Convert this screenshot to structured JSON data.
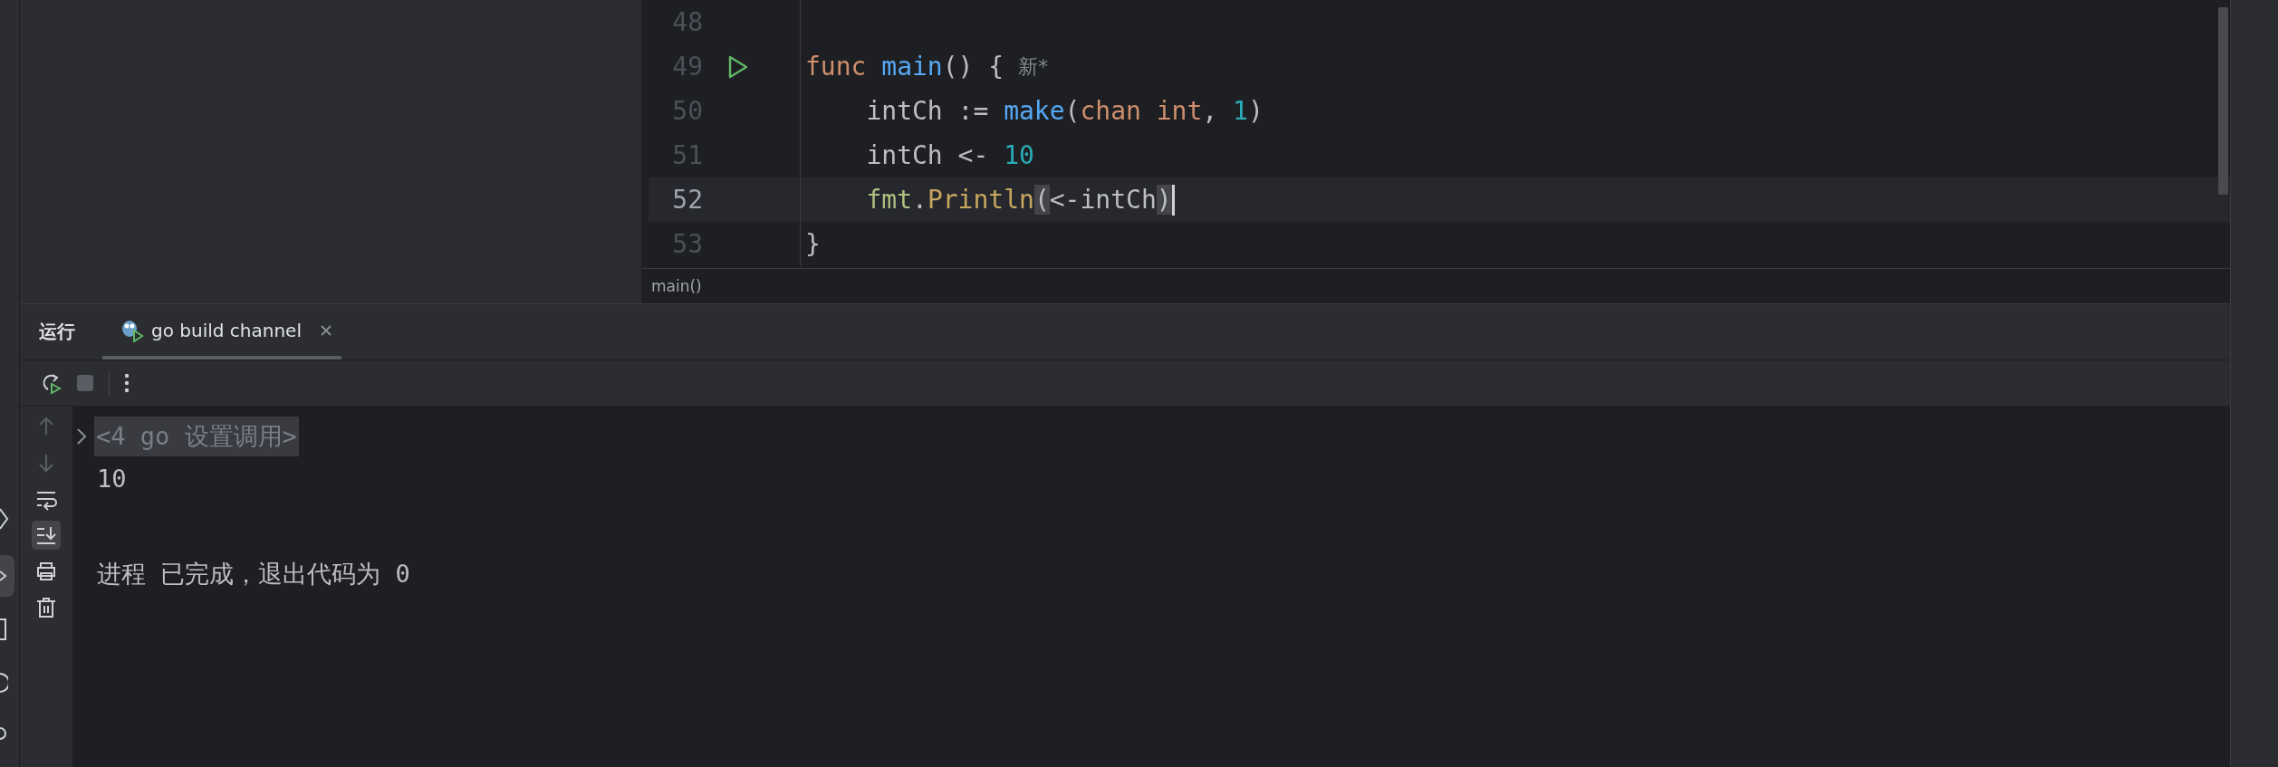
{
  "editor": {
    "lines": [
      {
        "number": "48",
        "current": false
      },
      {
        "number": "49",
        "current": false,
        "run_icon": true,
        "hint": "新*",
        "tokens": [
          {
            "kind": "keyword",
            "text": "func "
          },
          {
            "kind": "function",
            "text": "main"
          },
          {
            "kind": "plain",
            "text": "() {"
          }
        ]
      },
      {
        "number": "50",
        "current": false,
        "tokens": [
          {
            "kind": "plain",
            "text": "    intCh := "
          },
          {
            "kind": "call",
            "text": "make"
          },
          {
            "kind": "plain",
            "text": "("
          },
          {
            "kind": "keyword",
            "text": "chan int"
          },
          {
            "kind": "plain",
            "text": ", "
          },
          {
            "kind": "number",
            "text": "1"
          },
          {
            "kind": "plain",
            "text": ")"
          }
        ]
      },
      {
        "number": "51",
        "current": false,
        "tokens": [
          {
            "kind": "plain",
            "text": "    intCh <- "
          },
          {
            "kind": "number",
            "text": "10"
          }
        ]
      },
      {
        "number": "52",
        "current": true,
        "caret": true,
        "tokens": [
          {
            "kind": "package",
            "text": "    fmt"
          },
          {
            "kind": "plain",
            "text": "."
          },
          {
            "kind": "method",
            "text": "Println"
          },
          {
            "kind": "brace-match",
            "text": "("
          },
          {
            "kind": "plain",
            "text": "<-intCh"
          },
          {
            "kind": "brace-match",
            "text": ")"
          }
        ]
      },
      {
        "number": "53",
        "current": false,
        "tokens": [
          {
            "kind": "plain",
            "text": "}"
          }
        ]
      }
    ],
    "breadcrumb": "main()"
  },
  "run_panel": {
    "title": "运行",
    "tabs": [
      {
        "label": "go build channel",
        "selected": true
      }
    ],
    "tools": [
      {
        "kind": "up",
        "disabled": true,
        "on": false
      },
      {
        "kind": "down",
        "disabled": true,
        "on": false
      },
      {
        "kind": "wrap",
        "disabled": false,
        "on": false
      },
      {
        "kind": "scroll-end",
        "disabled": false,
        "on": true
      },
      {
        "kind": "print",
        "disabled": false,
        "on": false
      },
      {
        "kind": "trash",
        "disabled": false,
        "on": false
      }
    ],
    "console": [
      {
        "kind": "folded",
        "text": "<4 go 设置调用>"
      },
      {
        "kind": "output",
        "text": "10"
      },
      {
        "kind": "spacer"
      },
      {
        "kind": "output",
        "text": "进程 已完成，退出代码为 0"
      }
    ]
  }
}
